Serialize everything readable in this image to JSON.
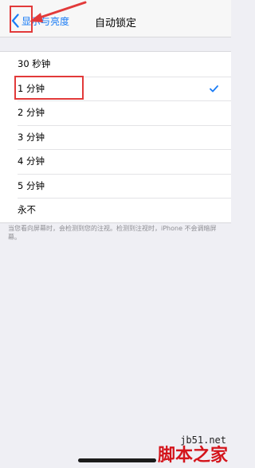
{
  "nav": {
    "back_label": "显示与亮度",
    "title": "自动锁定"
  },
  "options": [
    {
      "label": "30 秒钟",
      "selected": false
    },
    {
      "label": "1 分钟",
      "selected": true
    },
    {
      "label": "2 分钟",
      "selected": false
    },
    {
      "label": "3 分钟",
      "selected": false
    },
    {
      "label": "4 分钟",
      "selected": false
    },
    {
      "label": "5 分钟",
      "selected": false
    },
    {
      "label": "永不",
      "selected": false
    }
  ],
  "footer_note": "当您看向屏幕时，会检测到您的注视。检测到注视时，iPhone 不会调暗屏幕。",
  "colors": {
    "accent": "#1a7cf6",
    "annotation": "#e23a3a",
    "watermark": "#d4141b"
  },
  "watermark": {
    "site": "jb51.net",
    "brand": "脚本之家"
  }
}
